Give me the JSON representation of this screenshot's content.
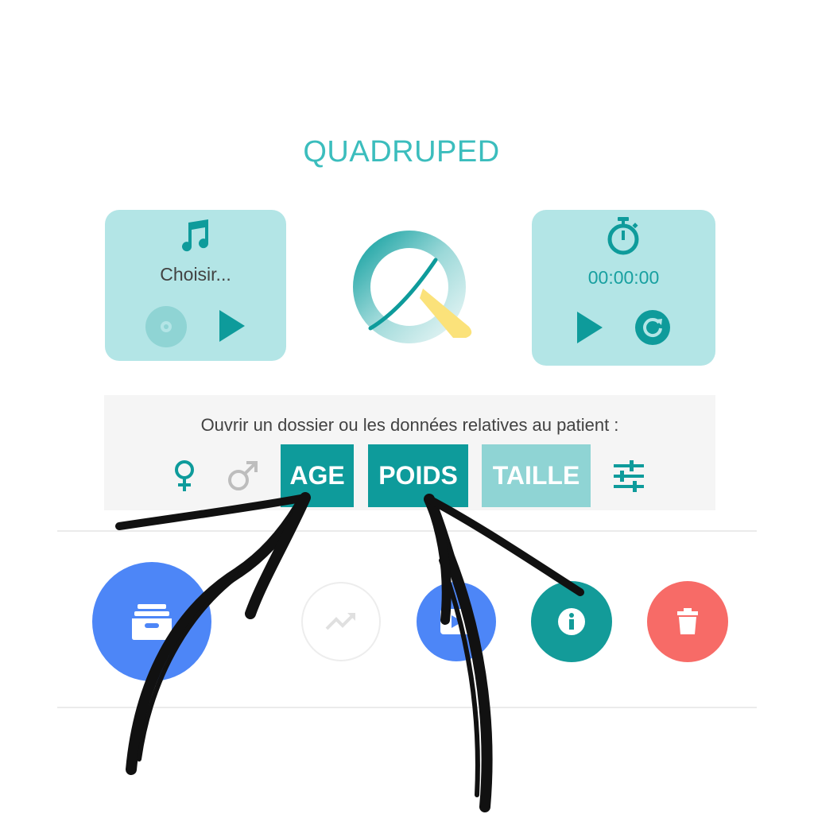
{
  "app": {
    "title": "QUADRUPED"
  },
  "music": {
    "label": "Choisir...",
    "note_icon": "music-note-icon",
    "disc_icon": "disc-icon",
    "play_icon": "play-icon"
  },
  "timer": {
    "value": "00:00:00",
    "stopwatch_icon": "stopwatch-icon",
    "play_icon": "play-icon",
    "reset_icon": "reset-icon"
  },
  "patient": {
    "prompt": "Ouvrir un dossier ou les données relatives au patient :",
    "female_icon": "female-icon",
    "male_icon": "male-icon",
    "buttons": {
      "age": "AGE",
      "poids": "POIDS",
      "taille": "TAILLE"
    },
    "settings_icon": "sliders-icon"
  },
  "actions": {
    "archive_icon": "archive-icon",
    "chart_icon": "trending-up-icon",
    "film_icon": "film-icon",
    "info_icon": "info-icon",
    "delete_icon": "trash-icon"
  },
  "colors": {
    "teal": "#0e9b9b",
    "teal_light": "#b3e5e6",
    "teal_disabled": "#8fd4d4",
    "title": "#3bbdbd",
    "blue": "#4d86f7",
    "red": "#f76b67",
    "yellow": "#fbe27a"
  }
}
